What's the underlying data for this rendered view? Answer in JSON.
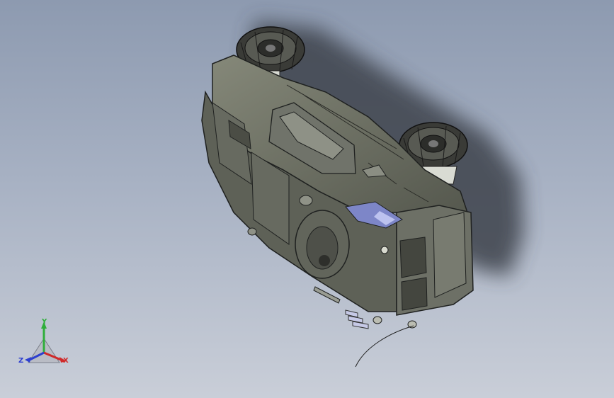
{
  "viewport": {
    "background_top": "#8d9ab0",
    "background_bottom": "#c9ced8"
  },
  "model": {
    "icon": "armored-vehicle-3d-model",
    "body_color": "#6c6f63",
    "edge_color": "#1f2120"
  },
  "triad": {
    "x_label": "X",
    "y_label": "Y",
    "z_label": "Z",
    "x_color": "#d02a2a",
    "y_color": "#2fae3a",
    "z_color": "#2d3fcf"
  }
}
